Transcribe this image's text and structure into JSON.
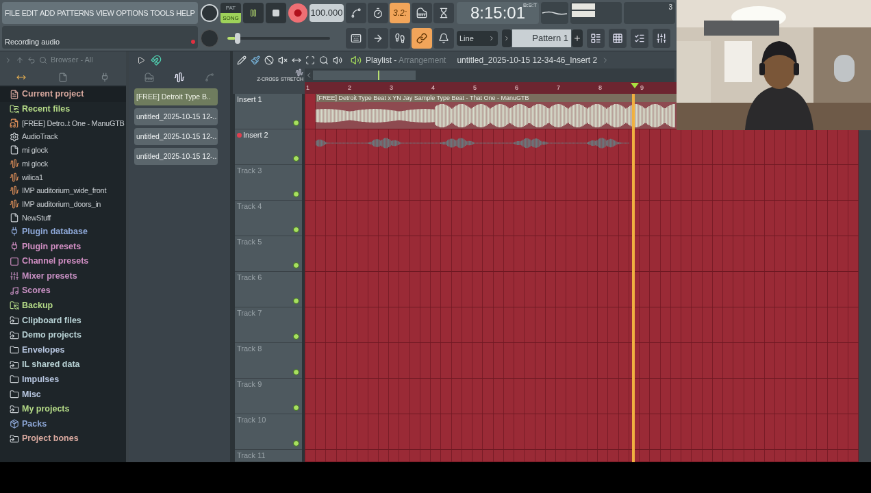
{
  "menu": [
    "FILE",
    "EDIT",
    "ADD",
    "PATTERNS",
    "VIEW",
    "OPTIONS",
    "TOOLS",
    "HELP"
  ],
  "hint": "Recording audio",
  "transport": {
    "modes": [
      {
        "label": "PAT",
        "selected": false
      },
      {
        "label": "SONG",
        "selected": true
      }
    ],
    "playing": true,
    "record_armed": true
  },
  "tempo": "100.000",
  "master_pitch": {
    "level": 0.08
  },
  "time": {
    "value": "8:15:01",
    "unit": "B:S:T"
  },
  "meter_reading": "3",
  "toolbar_top": [
    {
      "kind": "wave",
      "on": false
    },
    {
      "kind": "countdown",
      "on": false
    },
    {
      "kind": "text",
      "label": "3.2:",
      "on": true
    },
    {
      "kind": "keyplus",
      "on": false
    },
    {
      "kind": "wait",
      "on": false
    }
  ],
  "toolbar_bottom": [
    {
      "kind": "keyboard",
      "on": false
    },
    {
      "kind": "arrow",
      "on": false
    },
    {
      "kind": "steps",
      "on": false
    },
    {
      "kind": "link",
      "on": true
    },
    {
      "kind": "bell",
      "on": false
    }
  ],
  "snap": "Line",
  "pattern": "Pattern 1",
  "browser": {
    "title": "Browser - All",
    "items": [
      {
        "label": "Current project",
        "kind": "project",
        "color": "#d9a99f"
      },
      {
        "label": "Recent files",
        "kind": "recent",
        "color": "#b6dc88",
        "children": [
          {
            "label": "[FREE] Detro..t One - ManuGTB",
            "kind": "mp3"
          },
          {
            "label": "AudioTrack",
            "kind": "gear"
          },
          {
            "label": "mi glock",
            "kind": "file"
          },
          {
            "label": "mi glock",
            "kind": "sample"
          },
          {
            "label": "wilica1",
            "kind": "sample"
          },
          {
            "label": "IMP auditorium_wide_front",
            "kind": "impulse"
          },
          {
            "label": "IMP auditorium_doors_in",
            "kind": "impulse"
          },
          {
            "label": "NewStuff",
            "kind": "file"
          }
        ]
      },
      {
        "label": "Plugin database",
        "kind": "plug",
        "color": "#8ea8d8"
      },
      {
        "label": "Plugin presets",
        "kind": "plug",
        "color": "#d28fc4"
      },
      {
        "label": "Channel presets",
        "kind": "channel",
        "color": "#d28fc4"
      },
      {
        "label": "Mixer presets",
        "kind": "mixer",
        "color": "#c991c4"
      },
      {
        "label": "Scores",
        "kind": "note",
        "color": "#c991c4"
      },
      {
        "label": "Backup",
        "kind": "recent",
        "color": "#b6dc88"
      },
      {
        "label": "Clipboard files",
        "kind": "linkfolder",
        "color": "#b9d3d6"
      },
      {
        "label": "Demo projects",
        "kind": "linkfolder",
        "color": "#b9d3d6"
      },
      {
        "label": "Envelopes",
        "kind": "folder",
        "color": "#b7c6e0"
      },
      {
        "label": "IL shared data",
        "kind": "linkfolder",
        "color": "#b9d3d6"
      },
      {
        "label": "Impulses",
        "kind": "folder",
        "color": "#b7c6e0"
      },
      {
        "label": "Misc",
        "kind": "folder",
        "color": "#b7c6e0"
      },
      {
        "label": "My projects",
        "kind": "linkfolder",
        "color": "#b6dc88"
      },
      {
        "label": "Packs",
        "kind": "packs",
        "color": "#8ea8d8"
      },
      {
        "label": "Project bones",
        "kind": "linkfolder",
        "color": "#d9a99f"
      }
    ]
  },
  "picker": [
    {
      "label": "[FREE] Detroit Type B..",
      "selected": true
    },
    {
      "label": "untitled_2025-10-15 12-..",
      "selected": false
    },
    {
      "label": "untitled_2025-10-15 12-..",
      "selected": false
    },
    {
      "label": "untitled_2025-10-15 12-..",
      "selected": false
    }
  ],
  "playlist": {
    "title": "Playlist -",
    "subtitle": "Arrangement",
    "file": "untitled_2025-10-15 12-34-46_Insert 2",
    "zcross": "Z-CROSS",
    "stretch": "STRETCH",
    "ruler": [
      "1",
      "2",
      "3",
      "4",
      "5",
      "6",
      "7",
      "8",
      "9"
    ],
    "tracks": [
      {
        "name": "Insert 1",
        "clip": {
          "title": "[FREE] Detroit Type Beat x YN Jay Sample Type Beat - That One - ManuGTB",
          "kind": "full"
        }
      },
      {
        "name": "Insert 2",
        "armed": true,
        "clip": {
          "kind": "recorded"
        }
      },
      {
        "name": "Track 3"
      },
      {
        "name": "Track 4"
      },
      {
        "name": "Track 5"
      },
      {
        "name": "Track 6"
      },
      {
        "name": "Track 7"
      },
      {
        "name": "Track 8"
      },
      {
        "name": "Track 9"
      },
      {
        "name": "Track 10"
      },
      {
        "name": "Track 11"
      }
    ]
  }
}
